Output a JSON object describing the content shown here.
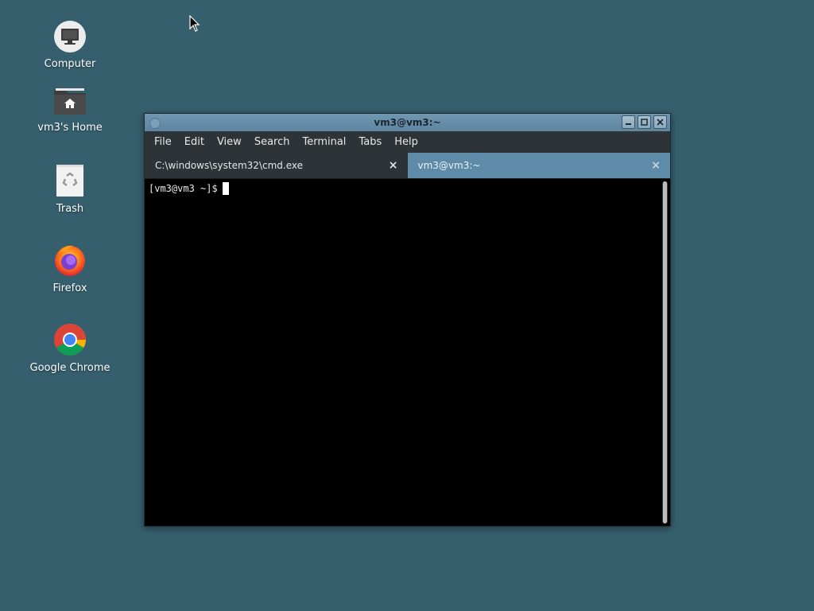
{
  "desktop": {
    "icons": [
      {
        "label": "Computer",
        "icon": "computer-icon"
      },
      {
        "label": "vm3's Home",
        "icon": "home-folder-icon"
      },
      {
        "label": "Trash",
        "icon": "trash-icon"
      },
      {
        "label": "Firefox",
        "icon": "firefox-icon"
      },
      {
        "label": "Google Chrome",
        "icon": "chrome-icon"
      }
    ]
  },
  "window": {
    "title": "vm3@vm3:~",
    "menu": [
      "File",
      "Edit",
      "View",
      "Search",
      "Terminal",
      "Tabs",
      "Help"
    ],
    "tabs": [
      {
        "label": "C:\\windows\\system32\\cmd.exe",
        "close": "×",
        "active": false
      },
      {
        "label": "vm3@vm3:~",
        "close": "×",
        "active": true
      }
    ],
    "prompt": "[vm3@vm3 ~]$"
  },
  "colors": {
    "desktop_bg": "#365f6e",
    "titlebar": "#6f97b0",
    "active_tab": "#5e8ba8",
    "terminal_bg": "#000000"
  }
}
